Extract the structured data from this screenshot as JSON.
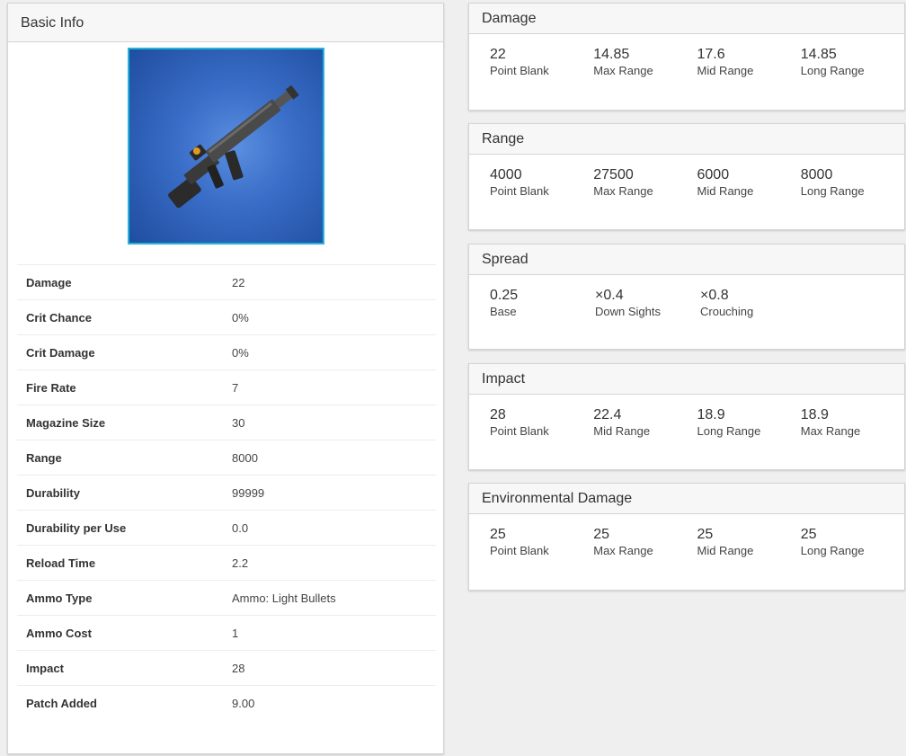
{
  "basic_info": {
    "title": "Basic Info",
    "image_alt": "tactical assault rifle",
    "stats": [
      {
        "label": "Damage",
        "value": "22"
      },
      {
        "label": "Crit Chance",
        "value": "0%"
      },
      {
        "label": "Crit Damage",
        "value": "0%"
      },
      {
        "label": "Fire Rate",
        "value": "7"
      },
      {
        "label": "Magazine Size",
        "value": "30"
      },
      {
        "label": "Range",
        "value": "8000"
      },
      {
        "label": "Durability",
        "value": "99999"
      },
      {
        "label": "Durability per Use",
        "value": "0.0"
      },
      {
        "label": "Reload Time",
        "value": "2.2"
      },
      {
        "label": "Ammo Type",
        "value": "Ammo: Light Bullets"
      },
      {
        "label": "Ammo Cost",
        "value": "1"
      },
      {
        "label": "Impact",
        "value": "28"
      },
      {
        "label": "Patch Added",
        "value": "9.00"
      }
    ]
  },
  "sections": {
    "damage": {
      "title": "Damage",
      "cells": [
        {
          "value": "22",
          "label": "Point Blank"
        },
        {
          "value": "14.85",
          "label": "Max Range"
        },
        {
          "value": "17.6",
          "label": "Mid Range"
        },
        {
          "value": "14.85",
          "label": "Long Range"
        }
      ]
    },
    "range": {
      "title": "Range",
      "cells": [
        {
          "value": "4000",
          "label": "Point Blank"
        },
        {
          "value": "27500",
          "label": "Max Range"
        },
        {
          "value": "6000",
          "label": "Mid Range"
        },
        {
          "value": "8000",
          "label": "Long Range"
        }
      ]
    },
    "spread": {
      "title": "Spread",
      "cells": [
        {
          "value": "0.25",
          "label": "Base"
        },
        {
          "value": "×0.4",
          "label": "Down Sights"
        },
        {
          "value": "×0.8",
          "label": "Crouching"
        }
      ]
    },
    "impact": {
      "title": "Impact",
      "cells": [
        {
          "value": "28",
          "label": "Point Blank"
        },
        {
          "value": "22.4",
          "label": "Mid Range"
        },
        {
          "value": "18.9",
          "label": "Long Range"
        },
        {
          "value": "18.9",
          "label": "Max Range"
        }
      ]
    },
    "environmental": {
      "title": "Environmental Damage",
      "cells": [
        {
          "value": "25",
          "label": "Point Blank"
        },
        {
          "value": "25",
          "label": "Max Range"
        },
        {
          "value": "25",
          "label": "Mid Range"
        },
        {
          "value": "25",
          "label": "Long Range"
        }
      ]
    }
  }
}
